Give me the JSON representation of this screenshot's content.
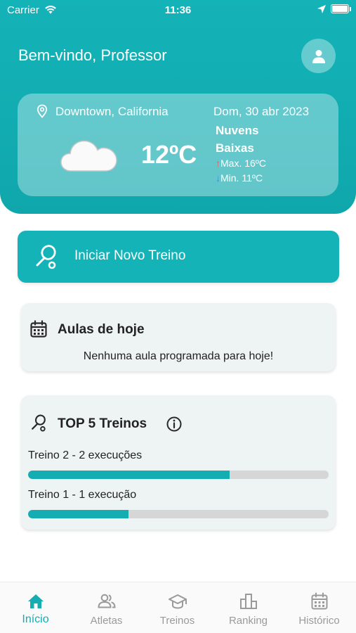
{
  "status_bar": {
    "carrier": "Carrier",
    "time": "11:36"
  },
  "header": {
    "welcome": "Bem-vindo, Professor"
  },
  "weather": {
    "location": "Downtown, California",
    "date": "Dom, 30 abr 2023",
    "temperature": "12ºC",
    "condition_line1": "Nuvens",
    "condition_line2": "Baixas",
    "max_arrow": "↑",
    "max": "Max. 16ºC",
    "min_arrow": "↓",
    "min": "Min. 11ºC"
  },
  "start_button": {
    "label": "Iniciar Novo Treino"
  },
  "classes_today": {
    "title": "Aulas de hoje",
    "empty_message": "Nenhuma aula programada para hoje!"
  },
  "top_trainings": {
    "title": "TOP 5 Treinos",
    "items": [
      {
        "label": "Treino 2 - 2 execuções",
        "progress": 0.67
      },
      {
        "label": "Treino 1 - 1 execução",
        "progress": 0.335
      }
    ]
  },
  "nav": {
    "items": [
      {
        "label": "Início",
        "icon": "home-icon",
        "active": true
      },
      {
        "label": "Atletas",
        "icon": "people-icon",
        "active": false
      },
      {
        "label": "Treinos",
        "icon": "graduation-cap-icon",
        "active": false
      },
      {
        "label": "Ranking",
        "icon": "podium-icon",
        "active": false
      },
      {
        "label": "Histórico",
        "icon": "calendar-icon",
        "active": false
      }
    ]
  },
  "colors": {
    "accent": "#14b3b8",
    "active_nav": "#14adb1",
    "inactive_nav": "#9a9a9a",
    "card_bg": "#eef3f3"
  }
}
